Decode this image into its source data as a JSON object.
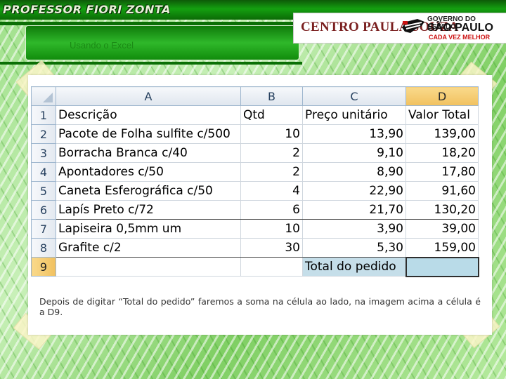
{
  "header": {
    "brand": "PROFESSOR FIORI ZONTA",
    "slide_title": "Usando o Excel"
  },
  "logo": {
    "left": "CENTRO PAULA SOUZA",
    "gov_line1": "GOVERNO DO ESTADO",
    "gov_line2": "SÃO PAULO",
    "gov_line3": "CADA VEZ MELHOR"
  },
  "sheet": {
    "columns": [
      "A",
      "B",
      "C",
      "D"
    ],
    "selected_column": "D",
    "selected_row": "9",
    "rows": [
      {
        "n": "1",
        "a": "Descrição",
        "b": "Qtd",
        "c": "Preço unitário",
        "d": "Valor Total"
      },
      {
        "n": "2",
        "a": "Pacote de Folha sulfite c/500",
        "b": "10",
        "c": "13,90",
        "d": "139,00"
      },
      {
        "n": "3",
        "a": "Borracha Branca c/40",
        "b": "2",
        "c": "9,10",
        "d": "18,20"
      },
      {
        "n": "4",
        "a": "Apontadores c/50",
        "b": "2",
        "c": "8,90",
        "d": "17,80"
      },
      {
        "n": "5",
        "a": "Caneta Esferográfica c/50",
        "b": "4",
        "c": "22,90",
        "d": "91,60"
      },
      {
        "n": "6",
        "a": "Lapís Preto c/72",
        "b": "6",
        "c": "21,70",
        "d": "130,20"
      },
      {
        "n": "7",
        "a": "Lapiseira 0,5mm um",
        "b": "10",
        "c": "3,90",
        "d": "39,00"
      },
      {
        "n": "8",
        "a": "Grafite c/2",
        "b": "30",
        "c": "5,30",
        "d": "159,00"
      },
      {
        "n": "9",
        "a": "",
        "b": "",
        "c": "Total do pedido",
        "d": ""
      }
    ]
  },
  "caption": "Depois de digitar “Total do pedido” faremos a soma na célula ao lado, na imagem acima a célula é a D9.",
  "colors": {
    "header_green": "#14a010",
    "selected_header": "#f1c15f",
    "active_cell": "#b9dbe8"
  }
}
